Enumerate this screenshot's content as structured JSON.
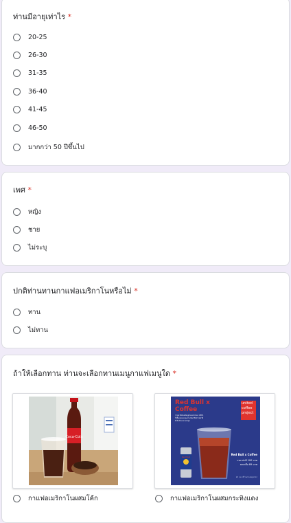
{
  "q_age": {
    "title": "ท่านมีอายุเท่าไร",
    "required": "*",
    "options": [
      "20-25",
      "26-30",
      "31-35",
      "36-40",
      "41-45",
      "46-50",
      "มากกว่า 50 ปีขึ้นไป"
    ]
  },
  "q_gender": {
    "title": "เพศ",
    "required": "*",
    "options": [
      "หญิง",
      "ชาย",
      "ไม่ระบุ"
    ]
  },
  "q_drink": {
    "title": "ปกติท่านทานกาแฟอเมริกาโนหรือไม่",
    "required": "*",
    "options": [
      "ทาน",
      "ไม่ทาน"
    ]
  },
  "q_menu": {
    "title": "ถ้าให้เลือกทาน ท่านจะเลือกทานเมนูกาแฟเมนูใด",
    "required": "*",
    "options": [
      {
        "label": "กาแฟอเมริกาโนผสมโค้ก",
        "image": "coke-americano-photo"
      },
      {
        "label": "กาแฟอเมริกาโนผสมกระทิงแดง",
        "image": "redbull-coffee-ad"
      }
    ],
    "poster": {
      "headline_1": "Red Bull x",
      "headline_2": "Coffee",
      "small_text": "กาแฟ Robusta สูตรเฉพาะของ UXPL\nให้ลิ้นหอมละมุนผ่าน Red Bull รสชาติ\nที่เข้มข้นและหอมนุ่ม",
      "brand": "united coffee project",
      "product_name": "Red Bull x Coffee",
      "price_line": "ราคาปกติ 100 บาท",
      "promo_line": "ลดเหลือ 89 บาท",
      "footer": "22 ก.ค. ที่ร้านกาแฟทุกสาขา"
    },
    "can_label": "Red Bull",
    "bottle_label": "Coca-Cola"
  },
  "colors": {
    "background": "#f0ebf8",
    "required": "#d93025",
    "radio_border": "#5f6368",
    "poster_bg": "#2b3a8a",
    "poster_red": "#e0342e"
  }
}
